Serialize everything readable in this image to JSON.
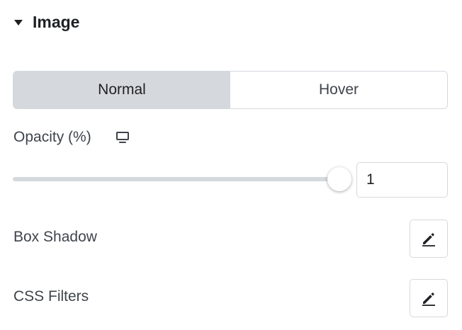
{
  "section": {
    "title": "Image",
    "caret_icon": "caret-down-icon"
  },
  "tabs": [
    {
      "label": "Normal",
      "active": true
    },
    {
      "label": "Hover",
      "active": false
    }
  ],
  "opacity": {
    "label": "Opacity (%)",
    "responsive_icon": "desktop-monitor-icon",
    "slider_value": 1,
    "input_value": "1"
  },
  "controls": {
    "box_shadow": {
      "label": "Box Shadow",
      "icon": "pencil-edit-icon"
    },
    "css_filters": {
      "label": "CSS Filters",
      "icon": "pencil-edit-icon"
    }
  },
  "colors": {
    "active_tab_bg": "#d5d8dc",
    "border": "#d5d8dc",
    "text_dark": "#1f2124",
    "text": "#3f444b"
  }
}
